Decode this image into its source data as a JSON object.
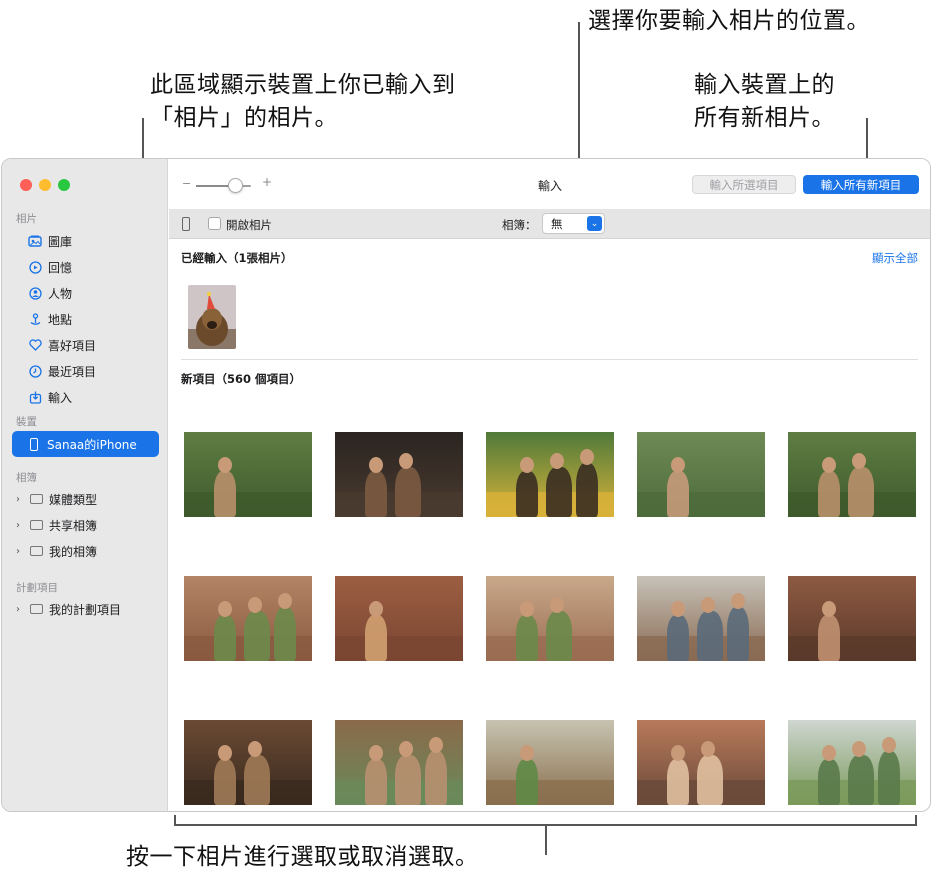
{
  "callouts": {
    "choose_location": "選擇你要輸入相片的位置。",
    "imported_area_line1": "此區域顯示裝置上你已輸入到",
    "imported_area_line2": "「相片」的相片。",
    "import_new_line1": "輸入裝置上的",
    "import_new_line2": "所有新相片。",
    "click_to_select": "按一下相片進行選取或取消選取。"
  },
  "sidebar": {
    "sections": {
      "photos": "相片",
      "devices": "裝置",
      "albums": "相簿",
      "projects": "計劃項目"
    },
    "items": [
      {
        "label": "圖庫",
        "icon": "library-icon"
      },
      {
        "label": "回憶",
        "icon": "memories-icon"
      },
      {
        "label": "人物",
        "icon": "people-icon"
      },
      {
        "label": "地點",
        "icon": "places-icon"
      },
      {
        "label": "喜好項目",
        "icon": "heart-icon"
      },
      {
        "label": "最近項目",
        "icon": "clock-icon"
      },
      {
        "label": "輸入",
        "icon": "import-icon"
      }
    ],
    "device": "Sanaa的iPhone",
    "albums": [
      "媒體類型",
      "共享相簿",
      "我的相簿"
    ],
    "projects": [
      "我的計劃項目"
    ]
  },
  "toolbar": {
    "title": "輸入",
    "import_selected": "輸入所選項目",
    "import_all_new": "輸入所有新項目",
    "zoom_level": 0.7
  },
  "subbar": {
    "open_photos": "開啟相片",
    "album_label": "相簿：",
    "album_value": "無"
  },
  "main": {
    "already_imported": "已經輸入（1張相片）",
    "show_all": "顯示全部",
    "new_items": "新項目（560 個項目）"
  },
  "colors": {
    "accent": "#1a74e8",
    "sidebar_bg": "#e8e8e9",
    "traffic_red": "#ff5f57",
    "traffic_yellow": "#febc2e",
    "traffic_green": "#28c840"
  }
}
